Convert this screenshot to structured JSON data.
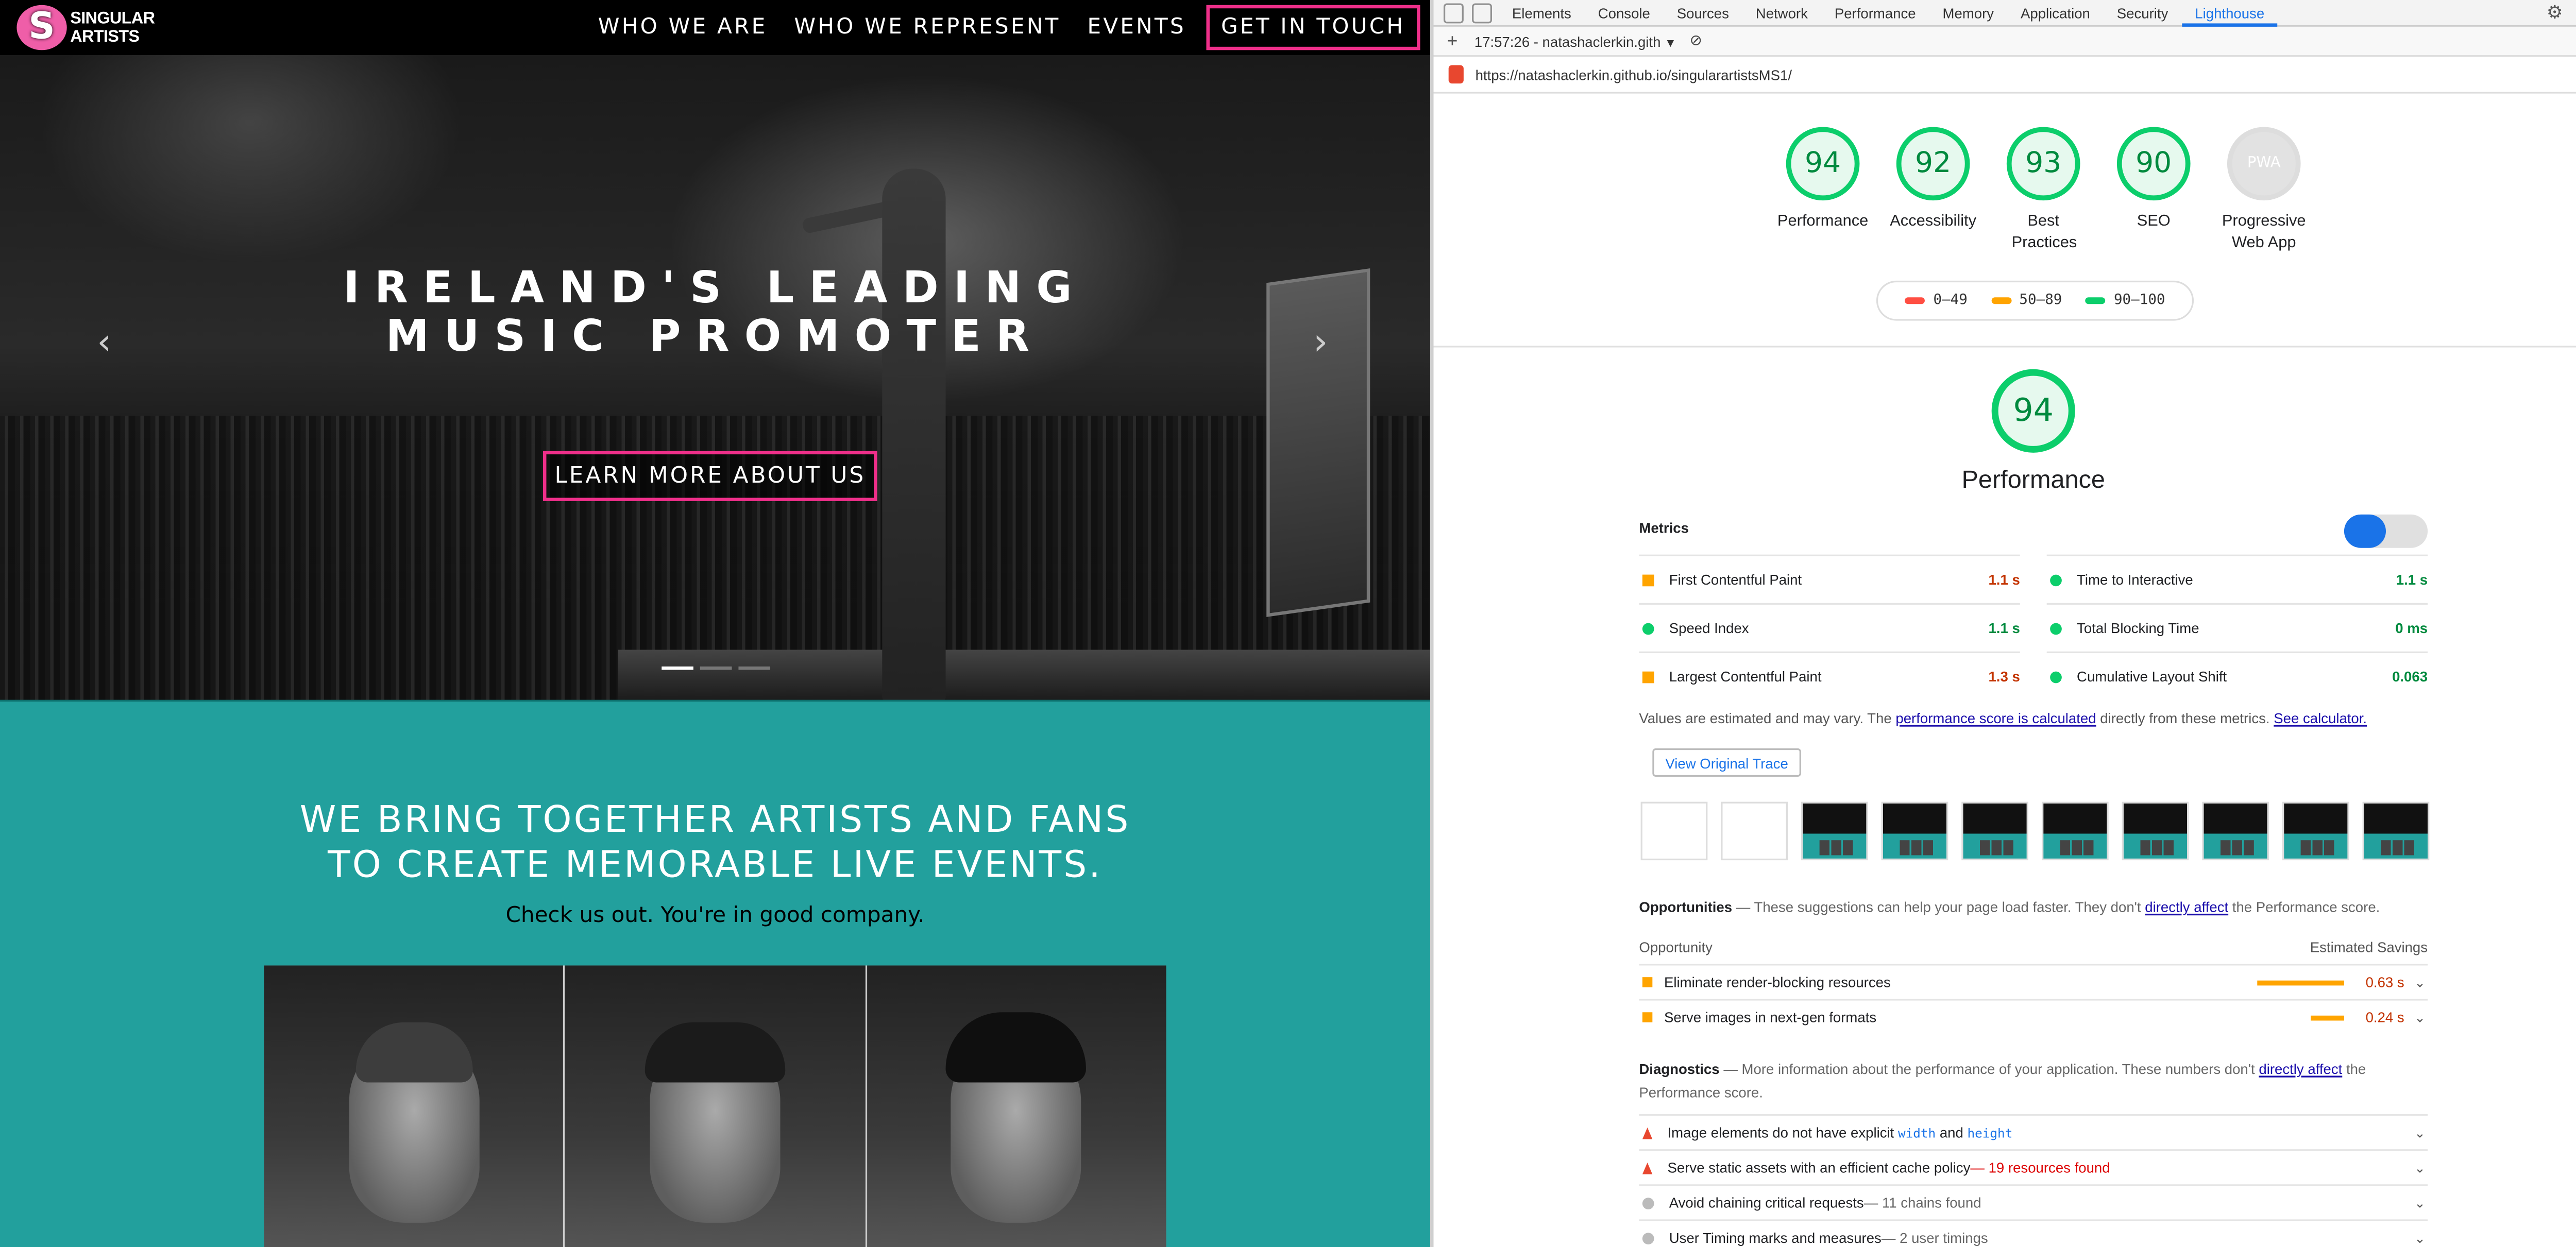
{
  "site": {
    "logo_letter": "S",
    "logo_line1": "SINGULAR",
    "logo_line2": "ARTISTS",
    "nav": [
      "WHO WE ARE",
      "WHO WE REPRESENT",
      "EVENTS",
      "GET IN TOUCH"
    ],
    "hero_line1": "IRELAND'S LEADING",
    "hero_line2": "MUSIC PROMOTER",
    "hero_button": "LEARN MORE ABOUT US",
    "prev_arrow": "‹",
    "next_arrow": "›",
    "carousel_active_index": 0,
    "tagline_line1": "WE BRING TOGETHER ARTISTS AND FANS",
    "tagline_line2": "TO CREATE MEMORABLE LIVE EVENTS.",
    "subtext": "Check us out. You're in good company.",
    "colors": {
      "accent": "#ef2f8a",
      "teal": "#22a09d"
    }
  },
  "devtools": {
    "tabs": [
      "Elements",
      "Console",
      "Sources",
      "Network",
      "Performance",
      "Memory",
      "Application",
      "Security",
      "Lighthouse"
    ],
    "selected_tab": "Lighthouse",
    "report_time": "17:57:26 - natashaclerkin.gith",
    "url": "https://natashaclerkin.github.io/singularartistsMS1/",
    "scores": [
      {
        "value": "94",
        "label": "Performance"
      },
      {
        "value": "92",
        "label": "Accessibility"
      },
      {
        "value": "93",
        "label": "Best Practices"
      },
      {
        "value": "90",
        "label": "SEO"
      },
      {
        "value": "PWA",
        "label": "Progressive Web App"
      }
    ],
    "legend": [
      "0–49",
      "50–89",
      "90–100"
    ],
    "legend_colors": [
      "#ff4e42",
      "#ffa400",
      "#0cce6b"
    ],
    "perf_score": "94",
    "perf_title": "Performance",
    "metrics_title": "Metrics",
    "metrics": [
      {
        "label": "First Contentful Paint",
        "value": "1.1 s",
        "shape": "square",
        "color": "orange"
      },
      {
        "label": "Time to Interactive",
        "value": "1.1 s",
        "shape": "circle",
        "color": "green"
      },
      {
        "label": "Speed Index",
        "value": "1.1 s",
        "shape": "circle",
        "color": "green"
      },
      {
        "label": "Total Blocking Time",
        "value": "0 ms",
        "shape": "circle",
        "color": "green"
      },
      {
        "label": "Largest Contentful Paint",
        "value": "1.3 s",
        "shape": "square",
        "color": "orange"
      },
      {
        "label": "Cumulative Layout Shift",
        "value": "0.063",
        "shape": "circle",
        "color": "green"
      }
    ],
    "note_prefix": "Values are estimated and may vary. The ",
    "note_link1": "performance score is calculated",
    "note_mid": " directly from these metrics. ",
    "note_link2": "See calculator.",
    "trace_button": "View Original Trace",
    "opportunities_title": "Opportunities",
    "opportunities_desc": " — These suggestions can help your page load faster. They don't ",
    "opportunities_link": "directly affect",
    "opportunities_tail": " the Performance score.",
    "opp_col1": "Opportunity",
    "opp_col2": "Estimated Savings",
    "opportunities": [
      {
        "label": "Eliminate render-blocking resources",
        "savings": "0.63 s",
        "bar_fraction": 1.0
      },
      {
        "label": "Serve images in next-gen formats",
        "savings": "0.24 s",
        "bar_fraction": 0.38
      }
    ],
    "diagnostics_title": "Diagnostics",
    "diagnostics_desc": " — More information about the performance of your application. These numbers don't ",
    "diagnostics_link": "directly affect",
    "diagnostics_tail": " the Performance score.",
    "diagnostics": [
      {
        "pre": "Image elements do not have explicit ",
        "code1": "width",
        "mid": " and ",
        "code2": "height",
        "post": ""
      },
      {
        "pre": "Serve static assets with an efficient cache policy",
        "post": " — 19 resources found"
      },
      {
        "pre": "Avoid chaining critical requests",
        "post": " — 11 chains found"
      },
      {
        "pre": "User Timing marks and measures",
        "post": " — 2 user timings"
      }
    ]
  }
}
